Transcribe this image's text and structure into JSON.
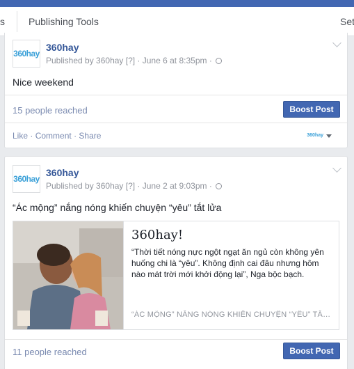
{
  "tabs": [
    {
      "label": "s"
    },
    {
      "label": "Publishing Tools"
    },
    {
      "label": "Set"
    }
  ],
  "posts": [
    {
      "page_name": "360hay",
      "avatar_text": "360hay",
      "meta": "Published by 360hay [?] · June 6 at 8:35pm ·",
      "text": "Nice weekend",
      "reached": "15 people reached",
      "boost_label": "Boost Post",
      "actions": {
        "like": "Like",
        "comment": "Comment",
        "share": "Share",
        "sep": "·"
      },
      "mini_avatar": "360hay"
    },
    {
      "page_name": "360hay",
      "avatar_text": "360hay",
      "meta": "Published by 360hay [?] · June 2 at 9:03pm ·",
      "text": "“Ác mộng” nắng nóng khiến chuyện “yêu” tắt lửa",
      "link_card": {
        "title": "360hay!",
        "description": "“Thời tiết nóng nực ngột ngạt ăn ngủ còn không yên huống chi là “yêu”. Không định cai đâu nhưng hôm nào mát trời mới khởi động lại”, Nga bộc bạch.",
        "caption": "“ÁC MỘNG” NẮNG NÓNG KHIẾN CHUYỆN “YÊU” TẮT LỬ..."
      },
      "reached": "11 people reached",
      "boost_label": "Boost Post"
    }
  ],
  "colors": {
    "brand": "#4267b2",
    "link": "#365899",
    "muted": "#90949c",
    "logo": "#3aa0d8"
  }
}
